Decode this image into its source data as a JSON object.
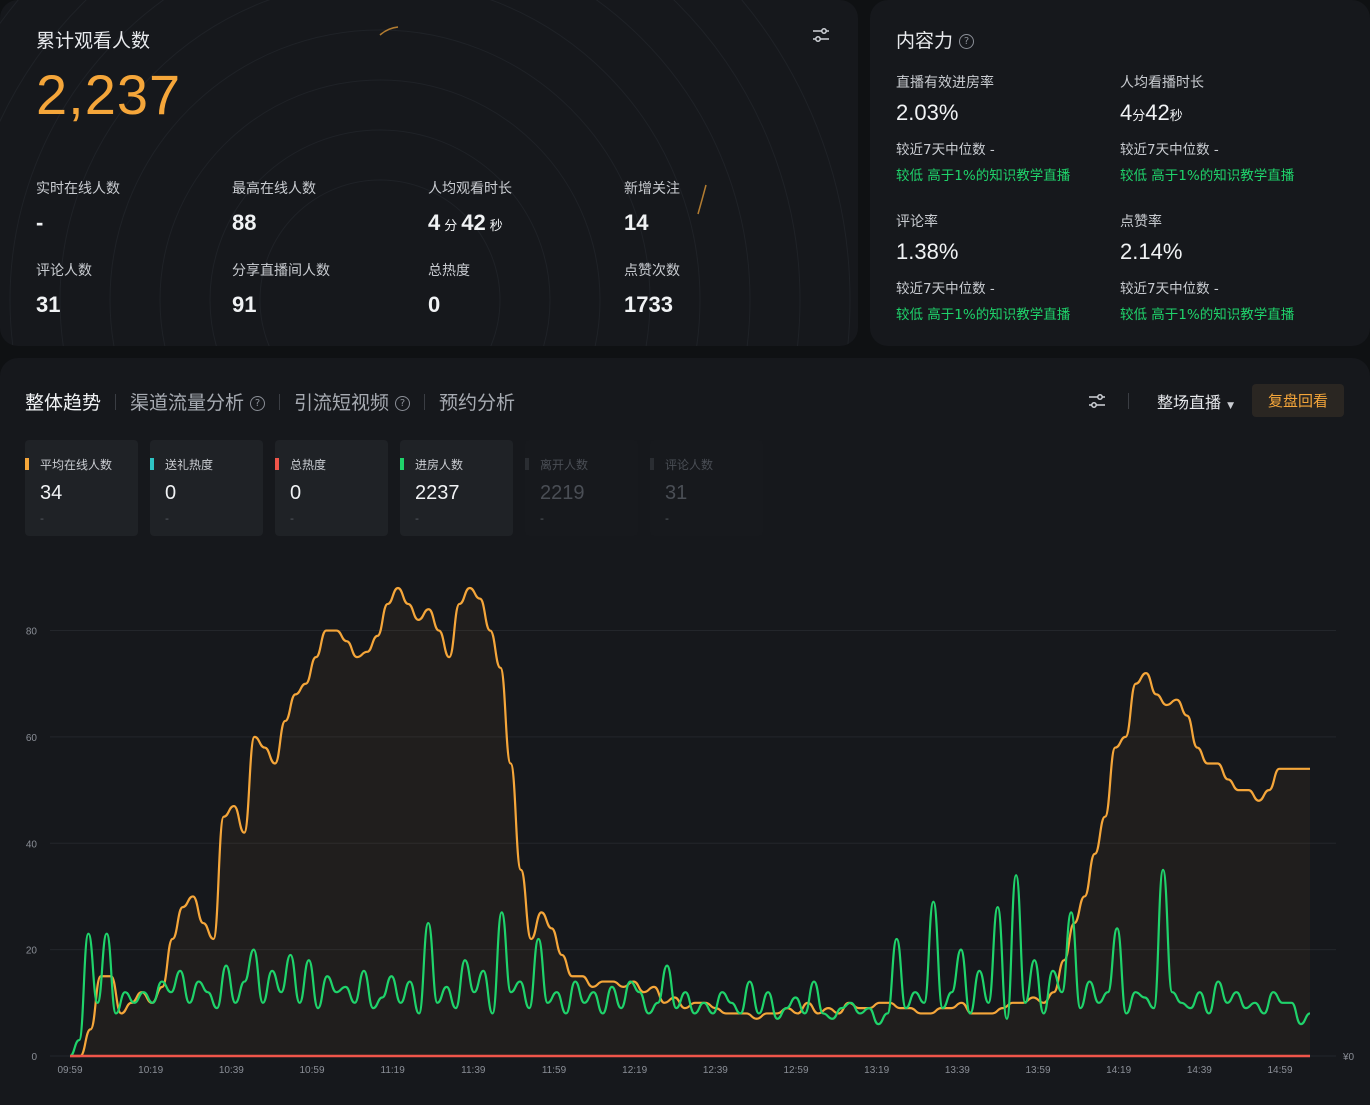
{
  "overview": {
    "title": "累计观看人数",
    "total": "2,237",
    "stats": [
      {
        "label": "实时在线人数",
        "value": "-"
      },
      {
        "label": "最高在线人数",
        "value": "88"
      },
      {
        "label": "人均观看时长",
        "min": "4",
        "min_unit": "分",
        "sec": "42",
        "sec_unit": "秒"
      },
      {
        "label": "新增关注",
        "value": "14"
      },
      {
        "label": "评论人数",
        "value": "31"
      },
      {
        "label": "分享直播间人数",
        "value": "91"
      },
      {
        "label": "总热度",
        "value": "0"
      },
      {
        "label": "点赞次数",
        "value": "1733"
      }
    ]
  },
  "content": {
    "title": "内容力",
    "help": "?",
    "metrics": [
      {
        "label": "直播有效进房率",
        "value": "2.03%",
        "compare": "较近7天中位数 -",
        "tag": "较低 高于1%的知识教学直播"
      },
      {
        "label": "人均看播时长",
        "min": "4",
        "min_unit": "分",
        "sec": "42",
        "sec_unit": "秒",
        "compare": "较近7天中位数 -",
        "tag": "较低 高于1%的知识教学直播"
      },
      {
        "label": "评论率",
        "value": "1.38%",
        "compare": "较近7天中位数 -",
        "tag": "较低 高于1%的知识教学直播"
      },
      {
        "label": "点赞率",
        "value": "2.14%",
        "compare": "较近7天中位数 -",
        "tag": "较低 高于1%的知识教学直播"
      }
    ]
  },
  "trend": {
    "tabs": [
      {
        "label": "整体趋势",
        "active": true,
        "help": false
      },
      {
        "label": "渠道流量分析",
        "active": false,
        "help": true
      },
      {
        "label": "引流短视频",
        "active": false,
        "help": true
      },
      {
        "label": "预约分析",
        "active": false,
        "help": false
      }
    ],
    "dropdown": "整场直播",
    "replay_button": "复盘回看",
    "chips": [
      {
        "label": "平均在线人数",
        "value": "34",
        "sub": "-",
        "color": "#f5a63a",
        "active": true
      },
      {
        "label": "送礼热度",
        "value": "0",
        "sub": "-",
        "color": "#2ec4c4",
        "active": true
      },
      {
        "label": "总热度",
        "value": "0",
        "sub": "-",
        "color": "#f0554a",
        "active": true
      },
      {
        "label": "进房人数",
        "value": "2237",
        "sub": "-",
        "color": "#1fd36b",
        "active": true
      },
      {
        "label": "离开人数",
        "value": "2219",
        "sub": "-",
        "color": "#3a3d43",
        "active": false
      },
      {
        "label": "评论人数",
        "value": "31",
        "sub": "-",
        "color": "#3a3d43",
        "active": false
      }
    ]
  },
  "chart_data": {
    "type": "line",
    "x_labels": [
      "09:59",
      "10:19",
      "10:39",
      "10:59",
      "11:19",
      "11:39",
      "11:59",
      "12:19",
      "12:39",
      "12:59",
      "13:19",
      "13:39",
      "13:59",
      "14:19",
      "14:39",
      "14:59"
    ],
    "y_ticks": [
      0,
      20,
      40,
      60,
      80
    ],
    "ylim": [
      0,
      88
    ],
    "right_axis_label": "¥0",
    "grid": true,
    "series": [
      {
        "color": "#f5a63a",
        "values": [
          0,
          0,
          5,
          15,
          15,
          8,
          10,
          12,
          10,
          13,
          22,
          28,
          30,
          25,
          22,
          45,
          47,
          42,
          60,
          58,
          55,
          63,
          68,
          70,
          75,
          80,
          80,
          78,
          75,
          76,
          79,
          85,
          88,
          85,
          82,
          84,
          80,
          75,
          85,
          88,
          86,
          80,
          73,
          55,
          35,
          22,
          27,
          24,
          19,
          15,
          15,
          13,
          14,
          14,
          13,
          14,
          12,
          13,
          10,
          11,
          9,
          10,
          10,
          9,
          8,
          8,
          8,
          7,
          8,
          8,
          9,
          8,
          10,
          8,
          9,
          8,
          10,
          9,
          9,
          10,
          10,
          9,
          9,
          8,
          8,
          9,
          9,
          10,
          8,
          8,
          8,
          9,
          10,
          10,
          11,
          10,
          12,
          18,
          25,
          30,
          38,
          45,
          58,
          60,
          70,
          72,
          68,
          66,
          67,
          64,
          58,
          55,
          55,
          52,
          50,
          50,
          48,
          50,
          54,
          54,
          54,
          54
        ]
      },
      {
        "color": "#1fd36b",
        "values": [
          0,
          3,
          23,
          10,
          23,
          8,
          12,
          10,
          12,
          10,
          14,
          12,
          16,
          10,
          14,
          12,
          9,
          17,
          10,
          14,
          20,
          10,
          16,
          12,
          19,
          10,
          18,
          9,
          15,
          12,
          13,
          10,
          16,
          9,
          11,
          15,
          10,
          14,
          8,
          25,
          10,
          13,
          9,
          18,
          12,
          16,
          8,
          27,
          12,
          14,
          9,
          22,
          10,
          12,
          8,
          14,
          10,
          12,
          8,
          13,
          9,
          14,
          12,
          8,
          10,
          17,
          9,
          12,
          8,
          10,
          8,
          12,
          10,
          8,
          14,
          8,
          12,
          7,
          9,
          11,
          8,
          14,
          8,
          7,
          9,
          10,
          8,
          9,
          6,
          8,
          22,
          9,
          12,
          10,
          29,
          9,
          12,
          20,
          8,
          16,
          10,
          28,
          7,
          34,
          10,
          18,
          8,
          16,
          12,
          27,
          9,
          14,
          10,
          12,
          24,
          8,
          12,
          11,
          9,
          35,
          12,
          10,
          9,
          12,
          8,
          14,
          10,
          12,
          9,
          10,
          8,
          12,
          10,
          10,
          6,
          8
        ]
      },
      {
        "color": "#f0554a",
        "values": [
          0,
          0,
          0,
          0,
          0,
          0,
          0,
          0,
          0,
          0,
          0,
          0,
          0,
          0,
          0,
          0,
          0,
          0,
          0,
          0,
          0,
          0,
          0,
          0
        ]
      }
    ]
  }
}
